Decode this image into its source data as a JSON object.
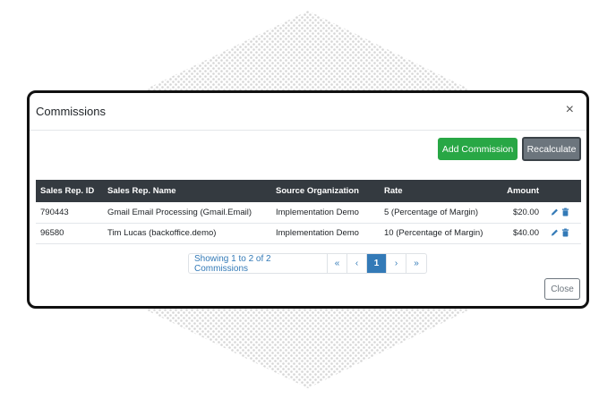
{
  "modal": {
    "title": "Commissions",
    "close_icon": "×",
    "add_button": "Add Commission",
    "recalc_button": "Recalculate",
    "close_button": "Close"
  },
  "table": {
    "headers": [
      "Sales Rep. ID",
      "Sales Rep. Name",
      "Source Organization",
      "Rate",
      "Amount",
      ""
    ],
    "rows": [
      {
        "id": "790443",
        "name": "Gmail Email Processing (Gmail.Email)",
        "org": "Implementation Demo",
        "rate": "5 (Percentage of Margin)",
        "amount": "$20.00"
      },
      {
        "id": "96580",
        "name": "Tim Lucas (backoffice.demo)",
        "org": "Implementation Demo",
        "rate": "10 (Percentage of Margin)",
        "amount": "$40.00"
      }
    ]
  },
  "pagination": {
    "info": "Showing 1 to 2 of 2 Commissions",
    "first": "«",
    "prev": "‹",
    "page": "1",
    "next": "›",
    "last": "»"
  },
  "colors": {
    "accent_green": "#28a745",
    "header_dark": "#343a40",
    "link_blue": "#337ab7"
  },
  "icons": {
    "edit": "pencil-icon",
    "delete": "trash-icon"
  }
}
